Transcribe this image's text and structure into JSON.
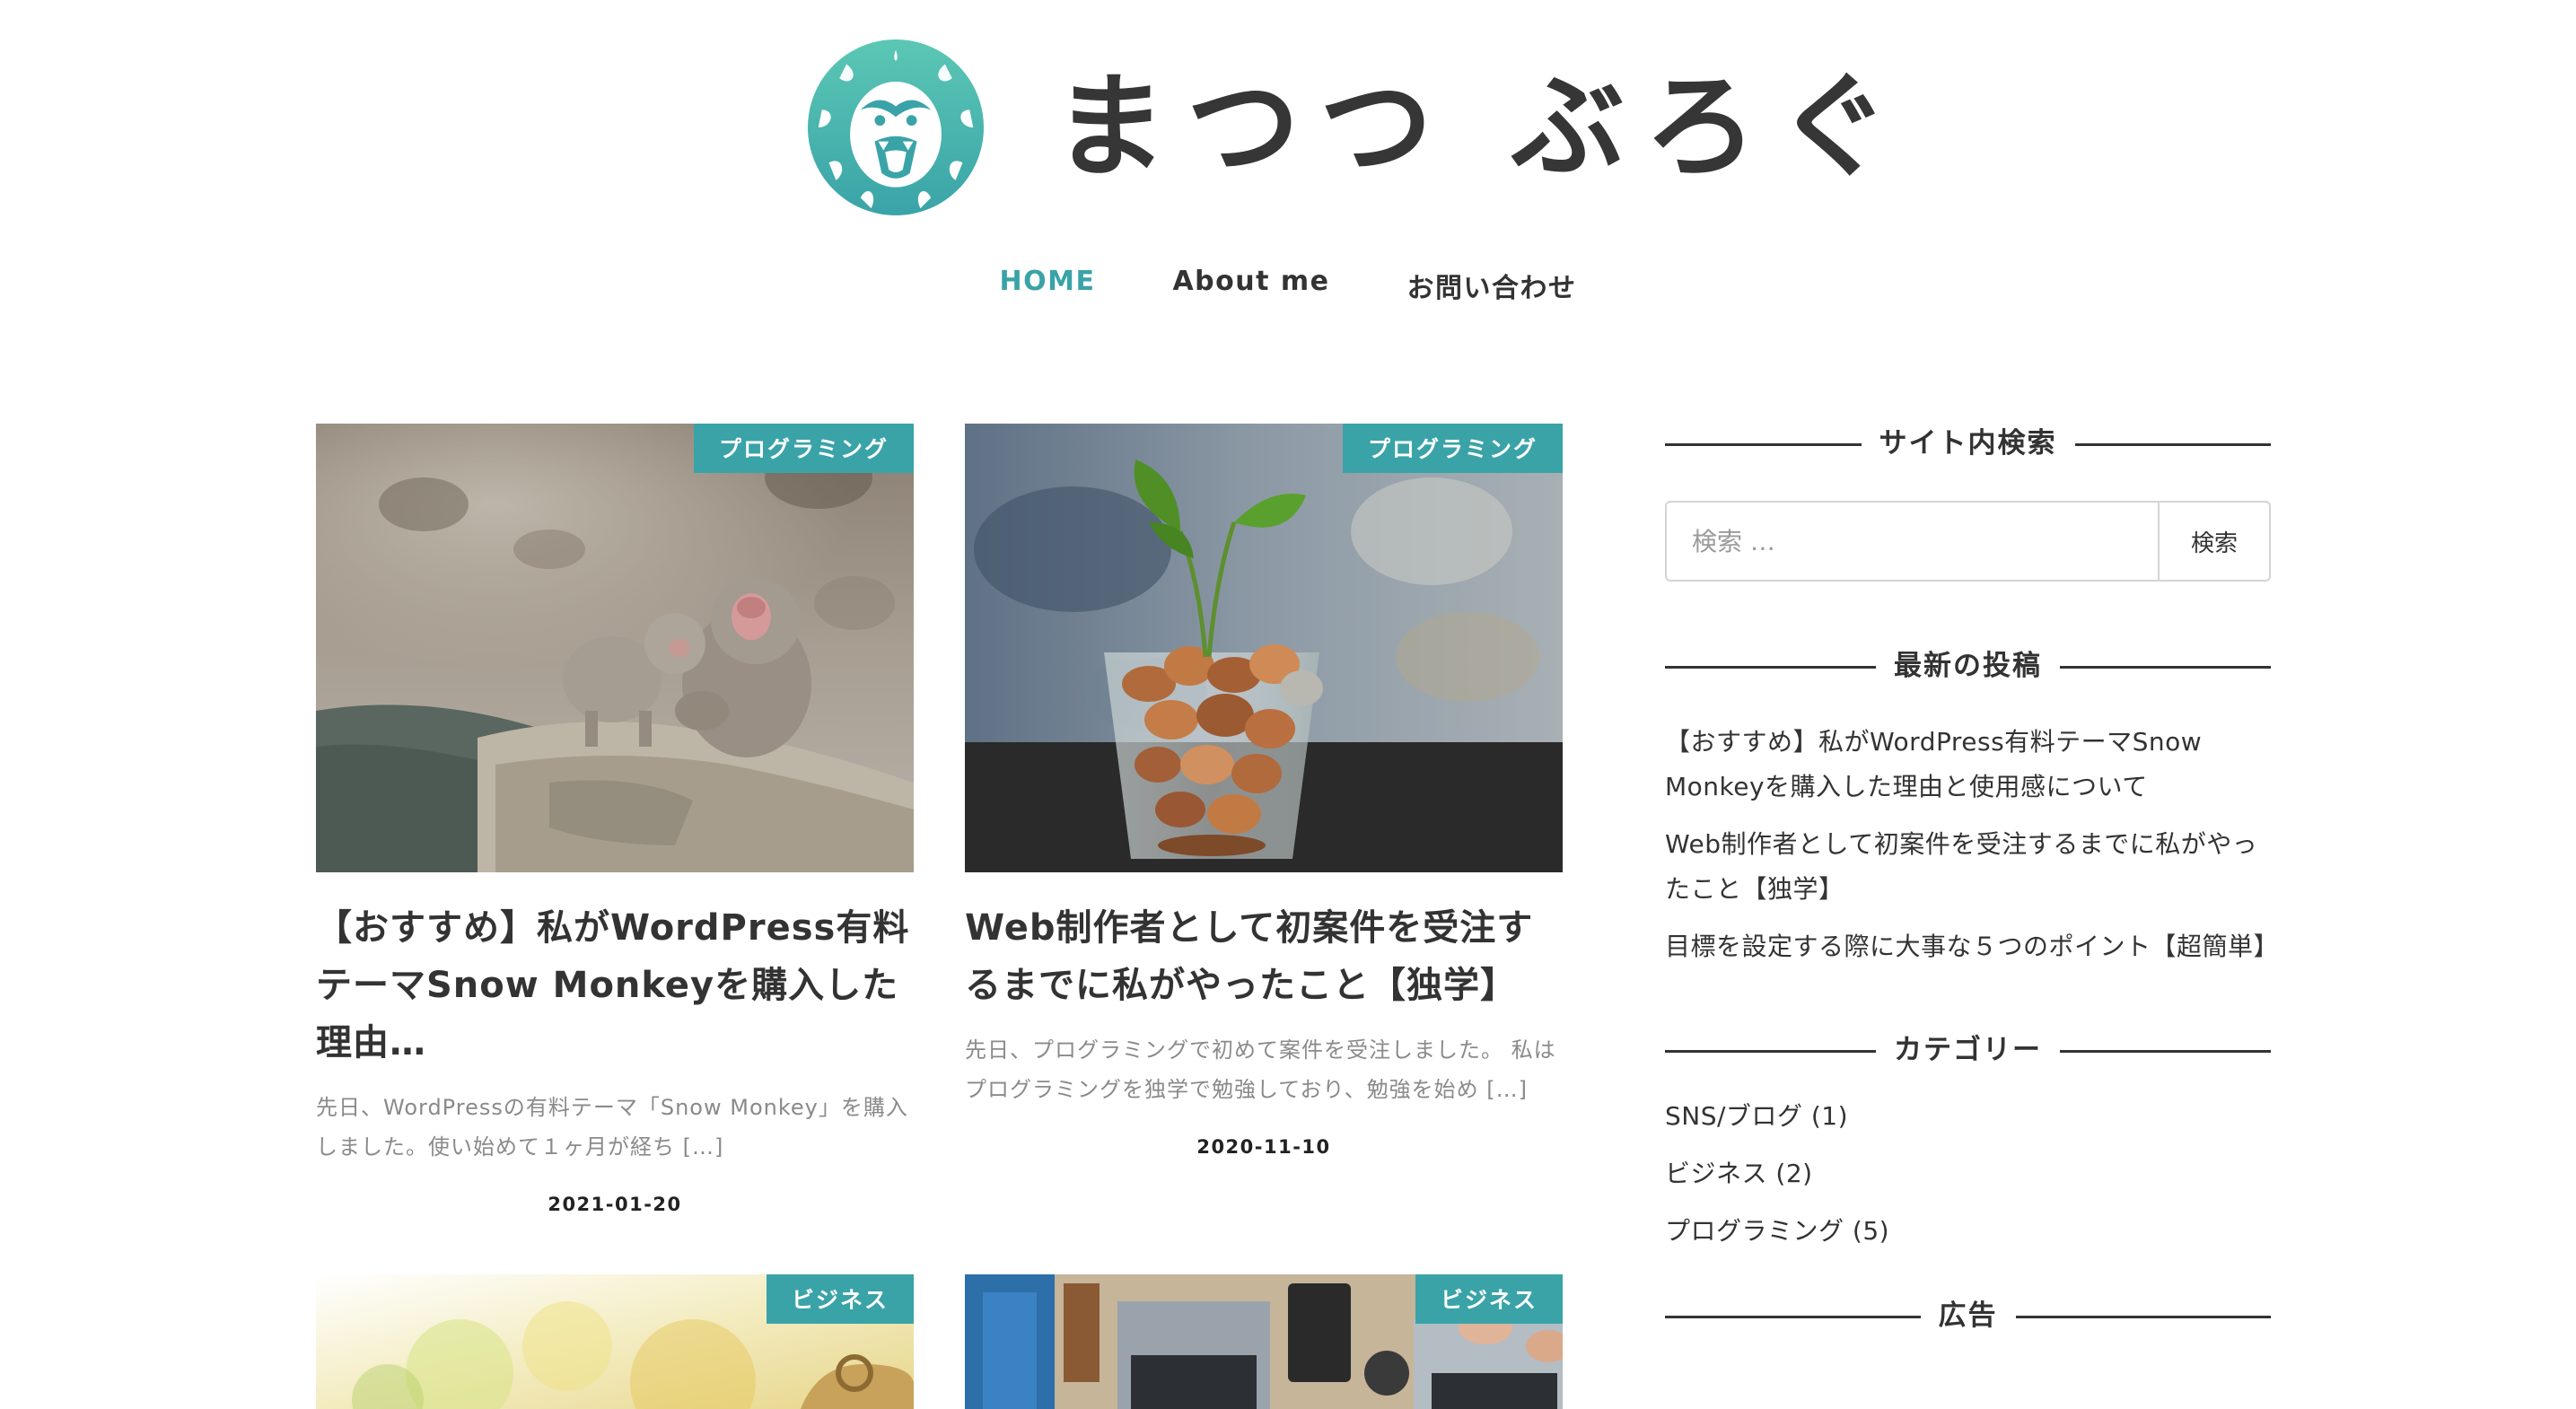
{
  "site": {
    "title": "まつつ ぶろぐ",
    "brand_color": "#3aa3a8"
  },
  "nav": {
    "items": [
      {
        "label": "HOME",
        "active": true
      },
      {
        "label": "About me",
        "active": false
      },
      {
        "label": "お問い合わせ",
        "active": false
      }
    ]
  },
  "posts": [
    {
      "category": "プログラミング",
      "title": "【おすすめ】私がWordPress有料テーマSnow Monkeyを購入した理由…",
      "excerpt": "先日、WordPressの有料テーマ「Snow Monkey」を購入しました。使い始めて１ヶ月が経ち […]",
      "date": "2021-01-20",
      "image": "snow-monkeys-photo"
    },
    {
      "category": "プログラミング",
      "title": "Web制作者として初案件を受注するまでに私がやったこと【独学】",
      "excerpt": "先日、プログラミングで初めて案件を受注しました。 私はプログラミングを独学で勉強しており、勉強を始め […]",
      "date": "2020-11-10",
      "image": "coins-plant-photo"
    },
    {
      "category": "ビジネス",
      "image": "bokeh-alarm-clock-photo"
    },
    {
      "category": "ビジネス",
      "image": "desk-laptops-photo"
    }
  ],
  "sidebar": {
    "search": {
      "title": "サイト内検索",
      "placeholder": "検索 …",
      "button_label": "検索"
    },
    "recent": {
      "title": "最新の投稿",
      "items": [
        "【おすすめ】私がWordPress有料テーマSnow Monkeyを購入した理由と使用感について",
        "Web制作者として初案件を受注するまでに私がやったこと【独学】",
        "目標を設定する際に大事な５つのポイント【超簡単】"
      ]
    },
    "categories": {
      "title": "カテゴリー",
      "items": [
        "SNS/ブログ (1)",
        "ビジネス (2)",
        "プログラミング (5)"
      ]
    },
    "ads": {
      "title": "広告"
    }
  }
}
